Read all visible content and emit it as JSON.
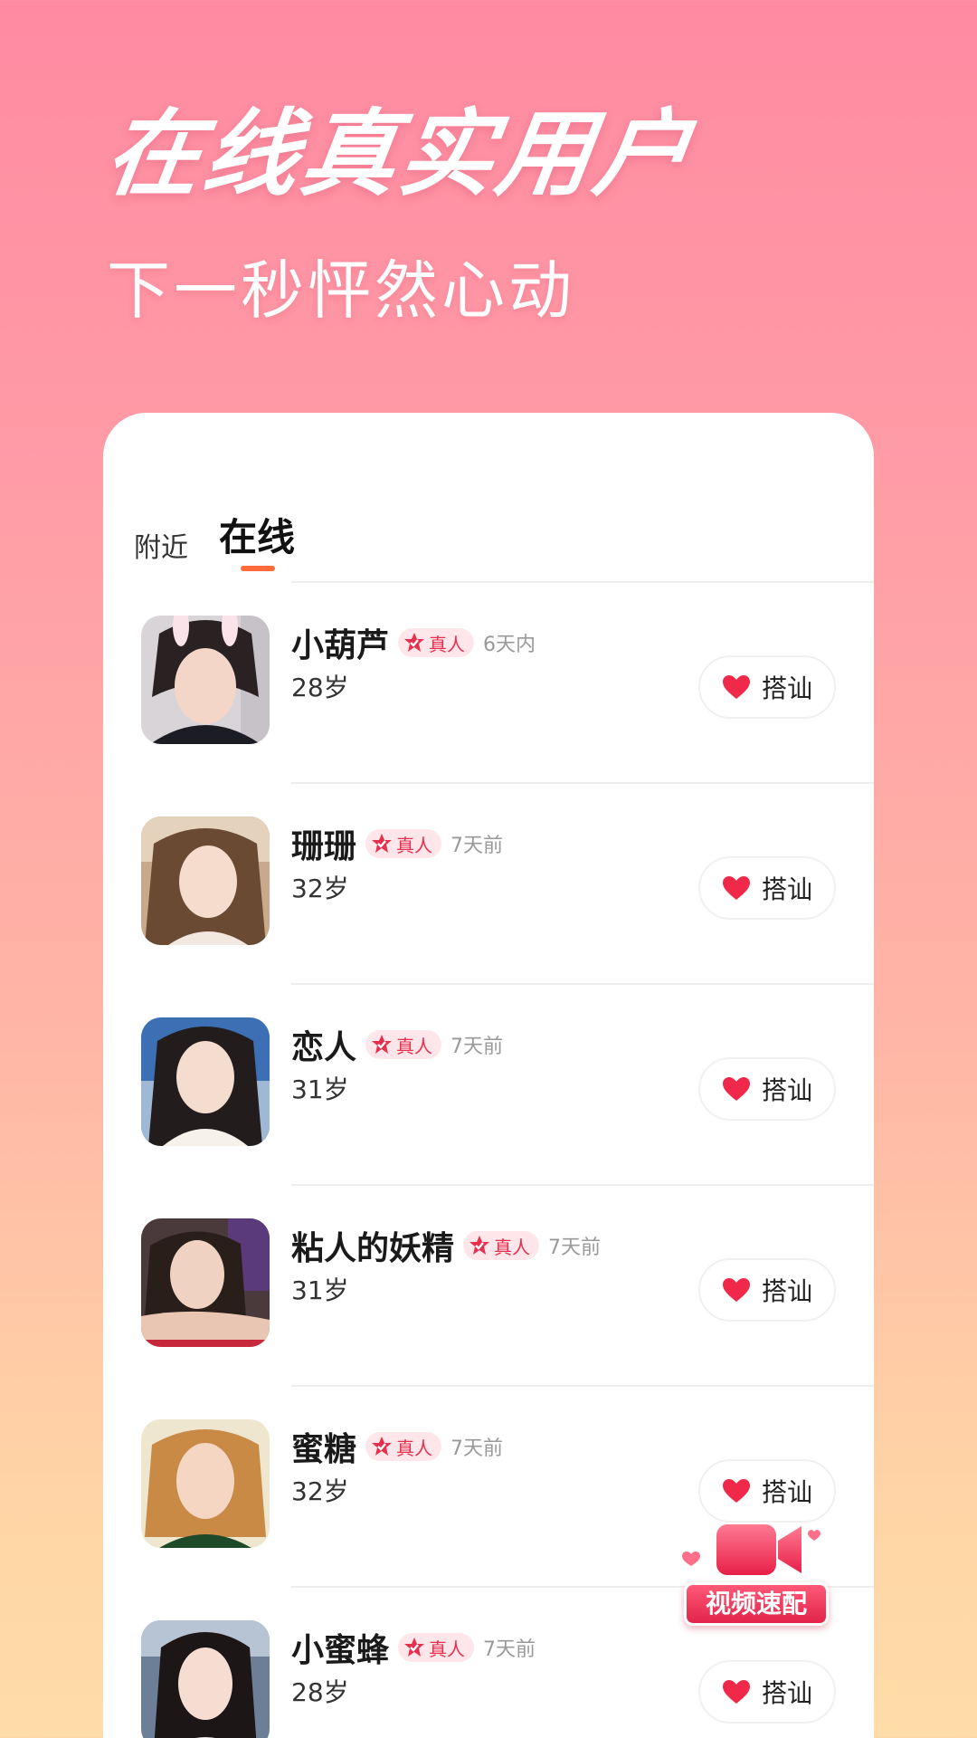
{
  "hero": {
    "title": "在线真实用户",
    "subtitle": "下一秒怦然心动"
  },
  "tabs": [
    {
      "label": "附近",
      "active": false
    },
    {
      "label": "在线",
      "active": true
    }
  ],
  "colors": {
    "accent": "#ff6a3a",
    "badge_text": "#e8304e",
    "heart": "#f0294a"
  },
  "users": [
    {
      "name": "小葫芦",
      "badge": "真人",
      "last_active": "6天内",
      "age": "28岁",
      "action": "搭讪"
    },
    {
      "name": "珊珊",
      "badge": "真人",
      "last_active": "7天前",
      "age": "32岁",
      "action": "搭讪"
    },
    {
      "name": "恋人",
      "badge": "真人",
      "last_active": "7天前",
      "age": "31岁",
      "action": "搭讪"
    },
    {
      "name": "粘人的妖精",
      "badge": "真人",
      "last_active": "7天前",
      "age": "31岁",
      "action": "搭讪"
    },
    {
      "name": "蜜糖",
      "badge": "真人",
      "last_active": "7天前",
      "age": "32岁",
      "action": "搭讪"
    },
    {
      "name": "小蜜蜂",
      "badge": "真人",
      "last_active": "7天前",
      "age": "28岁",
      "action": "搭讪"
    }
  ],
  "video_match": {
    "label": "视频速配",
    "icon": "video-camera-icon"
  }
}
